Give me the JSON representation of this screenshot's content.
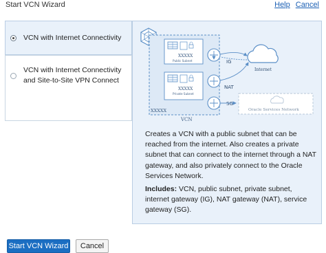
{
  "header": {
    "title": "Start VCN Wizard",
    "help_label": "Help",
    "cancel_label": "Cancel"
  },
  "options": [
    {
      "label": "VCN with Internet Connectivity",
      "selected": true
    },
    {
      "label": "VCN with Internet Connectivity and Site-to-Site VPN Connect",
      "selected": false
    }
  ],
  "diagram": {
    "vcn_label": "VCN",
    "vcn_cidr": "XXXXX",
    "public_subnet_cidr": "XXXXX",
    "public_subnet_label": "Public Subnet",
    "private_subnet_cidr": "XXXXX",
    "private_subnet_label": "Private Subnet",
    "ig_label": "IG",
    "nat_label": "NAT",
    "sg_label": "SG",
    "internet_label": "Internet",
    "oracle_services_label": "Oracle Services Network"
  },
  "description": "Creates a VCN with a public subnet that can be reached from the internet. Also creates a private subnet that can connect to the internet through a NAT gateway, and also privately connect to the Oracle Services Network.",
  "includes": {
    "heading": "Includes:",
    "text": " VCN, public subnet, private subnet, internet gateway (IG), NAT gateway (NAT), service gateway (SG)."
  },
  "footer": {
    "start_label": "Start VCN Wizard",
    "cancel_label": "Cancel"
  },
  "colors": {
    "accent": "#1b6ec2",
    "diagram_blue": "#5b8fc7",
    "panel_bg": "#e9f1fa"
  }
}
